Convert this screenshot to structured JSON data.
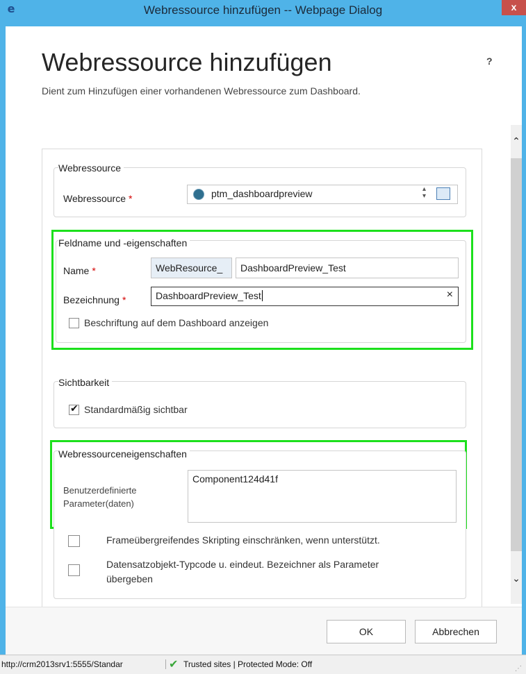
{
  "window": {
    "title": "Webressource hinzufügen -- Webpage Dialog",
    "close_label": "x",
    "app_icon": "ie-icon"
  },
  "page": {
    "title": "Webressource hinzufügen",
    "help": "?",
    "description": "Dient zum Hinzufügen einer vorhandenen Webressource zum Dashboard."
  },
  "webresource_group": {
    "legend": "Webressource",
    "label": "Webressource",
    "required": "*",
    "value": "ptm_dashboardpreview"
  },
  "field_group": {
    "legend": "Feldname und -eigenschaften",
    "name_label": "Name",
    "name_required": "*",
    "name_prefix": "WebResource_",
    "name_value": "DashboardPreview_Test",
    "label_label": "Bezeichnung",
    "label_required": "*",
    "label_value": "DashboardPreview_Test",
    "clear_label": "×",
    "show_label_checkbox": "Beschriftung auf dem Dashboard anzeigen"
  },
  "visibility_group": {
    "legend": "Sichtbarkeit",
    "default_visible": "Standardmäßig sichtbar"
  },
  "properties_group": {
    "legend": "Webressourceneigenschaften",
    "params_label_line1": "Benutzerdefinierte",
    "params_label_line2": "Parameter(daten)",
    "params_value": "Component124d41f",
    "restrict_scripting": "Frameübergreifendes Skripting einschränken, wenn unterstützt.",
    "pass_record_line1": "Datensatzobjekt-Typcode u. eindeut. Bezeichner als Parameter",
    "pass_record_line2": "übergeben"
  },
  "buttons": {
    "ok": "OK",
    "cancel": "Abbrechen"
  },
  "statusbar": {
    "url": "http://crm2013srv1:5555/Standar",
    "zone": "Trusted sites | Protected Mode: Off"
  },
  "colors": {
    "titlebar": "#4fb3e8",
    "highlight": "#1ce01c",
    "required": "#d40000"
  }
}
